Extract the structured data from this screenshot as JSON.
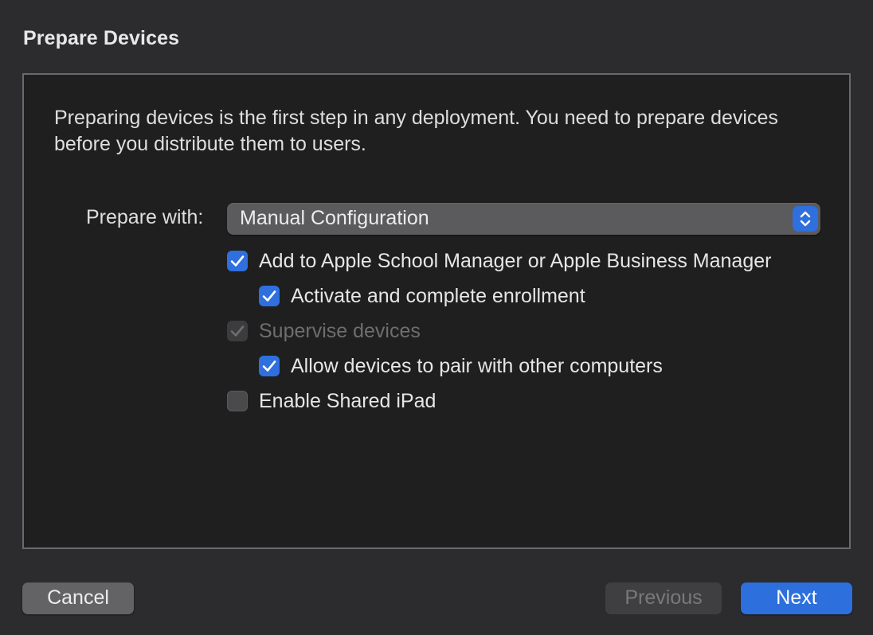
{
  "window": {
    "title": "Prepare Devices"
  },
  "intro_text": "Preparing devices is the first step in any deployment. You need to prepare devices before you distribute them to users.",
  "prepare_with": {
    "label": "Prepare with:",
    "selected": "Manual Configuration",
    "icon": "chevron-up-down-icon"
  },
  "options": {
    "add_to_manager": {
      "label": "Add to Apple School Manager or Apple Business Manager",
      "checked": true,
      "enabled": true
    },
    "activate_enrollment": {
      "label": "Activate and complete enrollment",
      "checked": true,
      "enabled": true
    },
    "supervise": {
      "label": "Supervise devices",
      "checked": true,
      "enabled": false
    },
    "allow_pair": {
      "label": "Allow devices to pair with other computers",
      "checked": true,
      "enabled": true
    },
    "shared_ipad": {
      "label": "Enable Shared iPad",
      "checked": false,
      "enabled": true
    }
  },
  "buttons": {
    "cancel": "Cancel",
    "previous": "Previous",
    "next": "Next"
  },
  "colors": {
    "accent": "#2f6fde",
    "background": "#2c2c2e",
    "panel": "#1f1f1f"
  }
}
